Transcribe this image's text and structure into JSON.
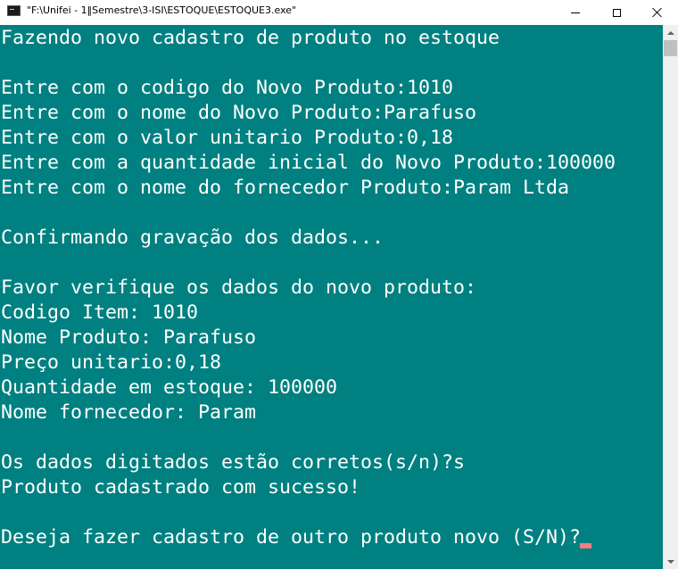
{
  "window": {
    "title": "\"F:\\Unifei - 1‖Semestre\\3-ISI\\ESTOQUE\\ESTOQUE3.exe\"",
    "icons": {
      "app": "console-app-icon",
      "minimize": "minimize-icon",
      "maximize": "maximize-icon",
      "close": "close-icon"
    }
  },
  "console": {
    "background": "#008080",
    "text_color": "#ffffff",
    "cursor_color": "#f08080",
    "lines": [
      "Fazendo novo cadastro de produto no estoque",
      "",
      "Entre com o codigo do Novo Produto:1010",
      "Entre com o nome do Novo Produto:Parafuso",
      "Entre com o valor unitario Produto:0,18",
      "Entre com a quantidade inicial do Novo Produto:100000",
      "Entre com o nome do fornecedor Produto:Param Ltda",
      "",
      "Confirmando gravação dos dados...",
      "",
      "Favor verifique os dados do novo produto:",
      "Codigo Item: 1010",
      "Nome Produto: Parafuso",
      "Preço unitario:0,18",
      "Quantidade em estoque: 100000",
      "Nome fornecedor: Param",
      "",
      "Os dados digitados estão corretos(s/n)?s",
      "Produto cadastrado com sucesso!",
      "",
      "Deseja fazer cadastro de outro produto novo (S/N)?"
    ]
  },
  "scrollbar": {
    "up_icon": "scroll-up-arrow-icon",
    "down_icon": "scroll-down-arrow-icon"
  }
}
